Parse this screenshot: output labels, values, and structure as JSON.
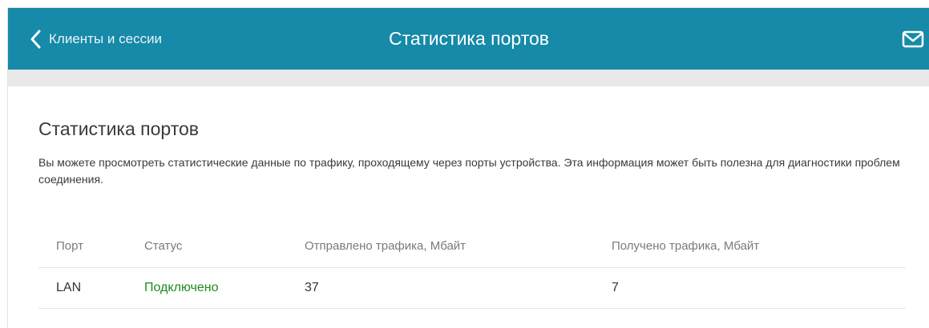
{
  "header": {
    "back_label": "Клиенты и сессии",
    "title": "Статистика портов",
    "back_icon": "chevron-left-icon",
    "mail_icon": "envelope-icon",
    "background_color": "#168aa8"
  },
  "main": {
    "title": "Статистика портов",
    "description": "Вы можете просмотреть статистические данные по трафику, проходящему через порты устройства. Эта информация может быть полезна для диагностики проблем соединения."
  },
  "table": {
    "columns": [
      "Порт",
      "Статус",
      "Отправлено трафика, Мбайт",
      "Получено трафика, Мбайт"
    ],
    "rows": [
      {
        "port": "LAN",
        "status": "Подключено",
        "sent": "37",
        "received": "7"
      }
    ],
    "status_color": "#1e8a1e"
  }
}
